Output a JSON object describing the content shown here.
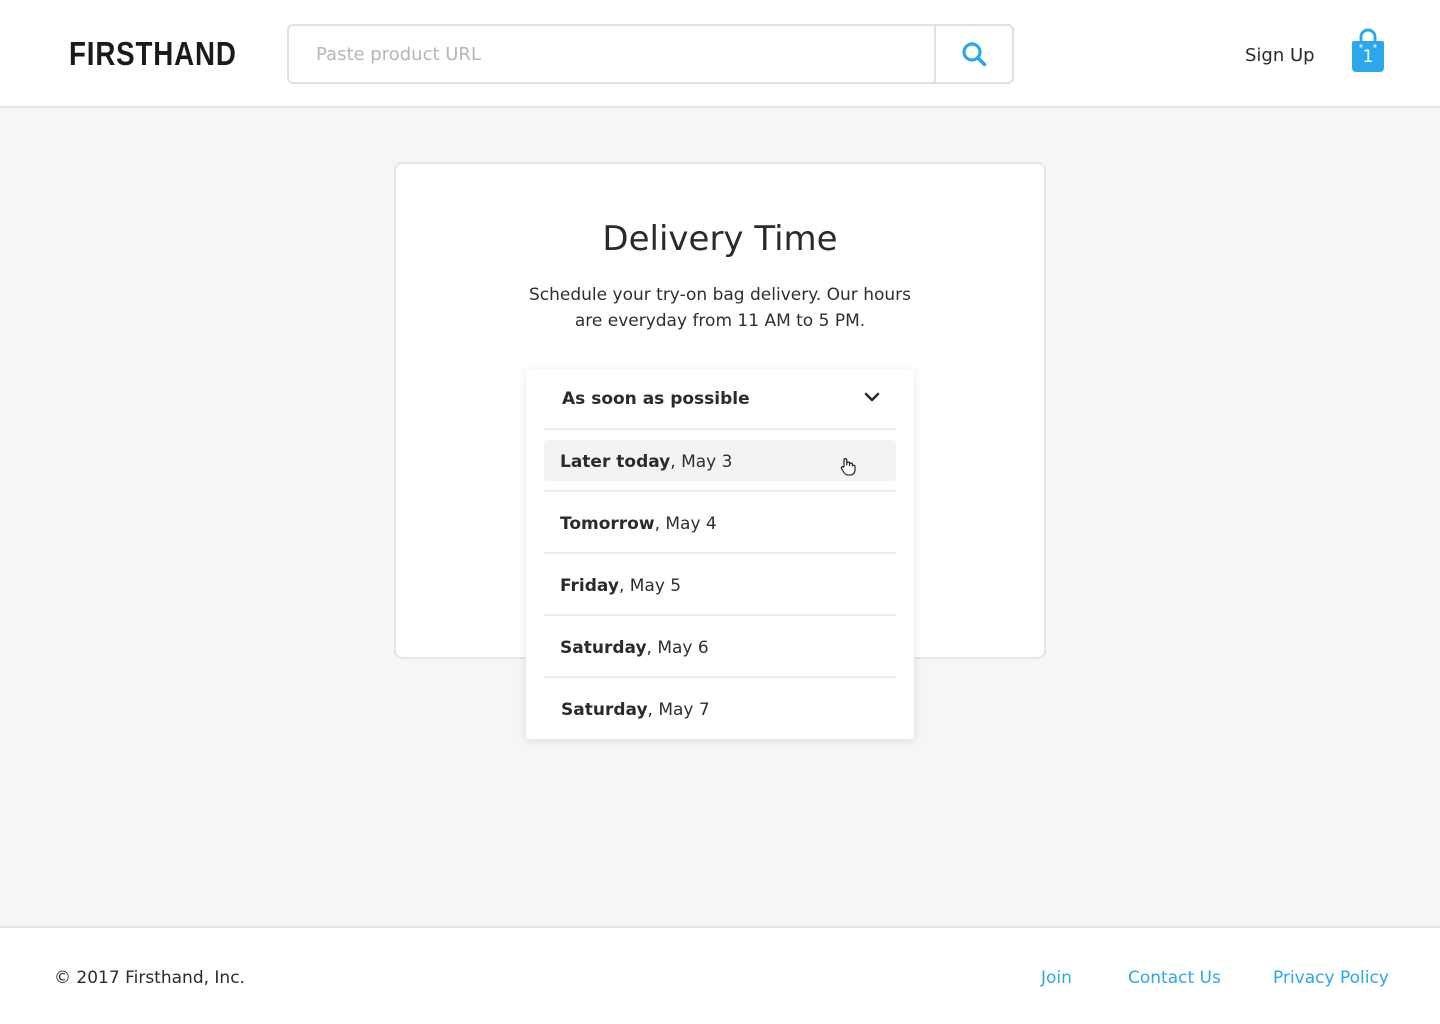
{
  "header": {
    "logo_text": "FIRSTHAND",
    "search_placeholder": "Paste product URL",
    "search_icon": "search-icon",
    "signup_label": "Sign Up",
    "cart_icon": "shopping-bag-icon",
    "cart_count": "1"
  },
  "main": {
    "title": "Delivery Time",
    "subtitle": "Schedule your try-on bag delivery. Our hours are everyday from 11 AM to 5 PM.",
    "dropdown": {
      "selected": "As soon as possible",
      "chevron_icon": "chevron-down-icon",
      "options": [
        {
          "day": "Later today",
          "date": ", May 3"
        },
        {
          "day": "Tomorrow",
          "date": ", May 4"
        },
        {
          "day": "Friday",
          "date": ", May 5"
        },
        {
          "day": "Saturday",
          "date": ", May 6"
        },
        {
          "day": "Saturday",
          "date": ", May 7"
        }
      ],
      "hovered_index": 0
    }
  },
  "footer": {
    "copyright": "© 2017 Firsthand, Inc.",
    "links": [
      "Join",
      "Contact Us",
      "Privacy Policy"
    ]
  },
  "colors": {
    "accent": "#2ea6ec",
    "background": "#f6f6f6",
    "text": "#2b2b2b"
  }
}
